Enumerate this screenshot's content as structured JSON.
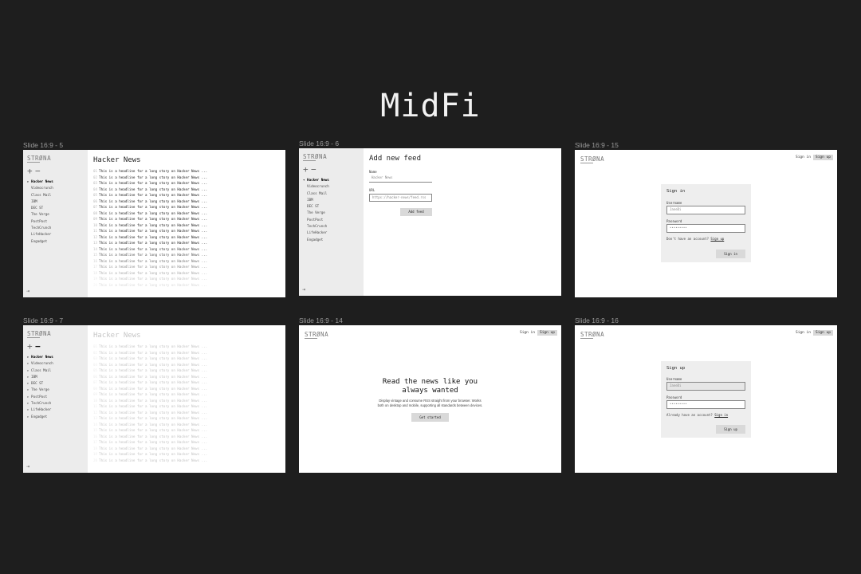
{
  "page_title": "MidFi",
  "brand": "STRØNA",
  "slides": {
    "s5": {
      "label": "Slide 16:9 - 5",
      "feed_title": "Hacker News",
      "plus_icon": "+",
      "minus_icon": "−",
      "exit_icon": "⇥",
      "sidebar_items": [
        "Hacker News",
        "Videocrunch",
        "Class Mail",
        "IBM",
        "DEC ST",
        "The Verge",
        "PostPost",
        "TechCrunch",
        "LifeHacker",
        "Engadget"
      ]
    },
    "s6": {
      "label": "Slide 16:9 - 6",
      "heading": "Add new feed",
      "name_label": "Name",
      "name_value": "Hacker News",
      "url_label": "URL",
      "url_value": "https://hacker-news/feed.rss",
      "add_button": "Add feed",
      "plus_icon": "+",
      "minus_icon": "−",
      "exit_icon": "⇥",
      "sidebar_items": [
        "Hacker News",
        "Videocrunch",
        "Class Mail",
        "IBM",
        "DEC ST",
        "The Verge",
        "PostPost",
        "TechCrunch",
        "LifeHacker",
        "Engadget"
      ]
    },
    "s15": {
      "label": "Slide 16:9 - 15",
      "nav_signin": "Sign in",
      "nav_signup": "Sign up",
      "card_title": "Sign in",
      "username_label": "Username",
      "username_value": "JaneDi",
      "password_label": "Password",
      "password_value": "•••••••••",
      "no_account_text": "Don't have an account?",
      "no_account_link": "Sign up",
      "submit": "Sign in"
    },
    "s7": {
      "label": "Slide 16:9 - 7",
      "feed_title": "Hacker News",
      "plus_icon": "+",
      "minus_icon": "−",
      "exit_icon": "⇥",
      "sidebar_items": [
        "Hacker News",
        "Videocrunch",
        "Class Mail",
        "IBM",
        "DEC ST",
        "The Verge",
        "PostPost",
        "TechCrunch",
        "LifeHacker",
        "Engadget"
      ]
    },
    "s14": {
      "label": "Slide 16:9 - 14",
      "nav_signin": "Sign in",
      "nav_signup": "Sign up",
      "headline_1": "Read the news like you",
      "headline_2": "always wanted",
      "body_1": "Display vintage and consume RSS straight from your browser. Works",
      "body_2": "both on desktop and mobile, supporting all standards between devices.",
      "cta": "Get started"
    },
    "s16": {
      "label": "Slide 16:9 - 16",
      "nav_signin": "Sign in",
      "nav_signup": "Sign up",
      "card_title": "Sign up",
      "username_label": "Username",
      "username_value": "JaneDi",
      "password_label": "Password",
      "password_value": "•••••••••",
      "have_account_text": "Already have an account?",
      "have_account_link": "Sign in",
      "submit": "Sign up"
    }
  },
  "headline_text": "This is a headline for a long story on Hacker News ...",
  "headline_numbers": [
    "01",
    "02",
    "03",
    "04",
    "05",
    "06",
    "07",
    "08",
    "09",
    "10",
    "11",
    "12",
    "13",
    "14",
    "15",
    "16",
    "17",
    "18",
    "19",
    "20"
  ]
}
